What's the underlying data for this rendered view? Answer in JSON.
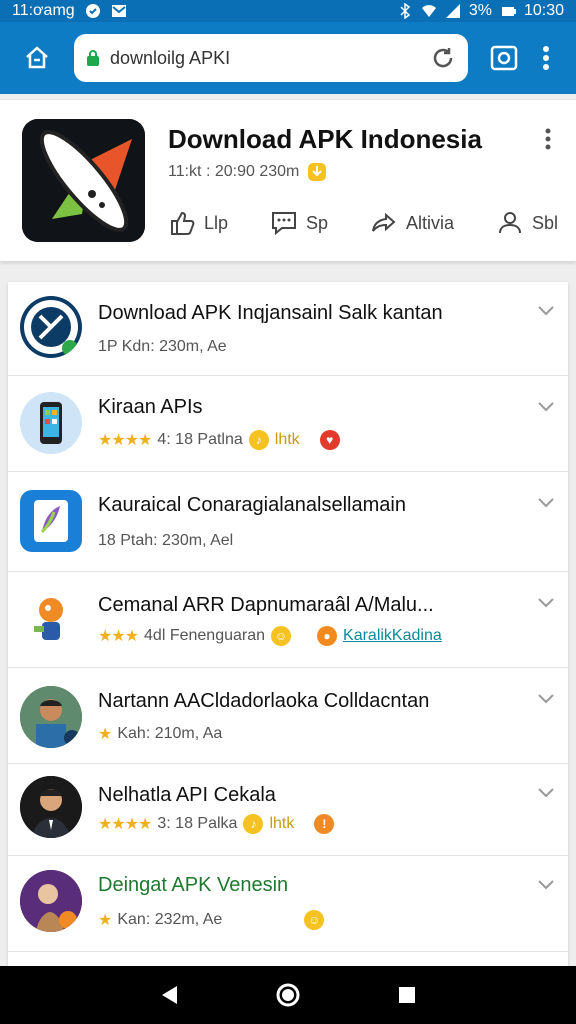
{
  "status_bar": {
    "time_left": "11:ơamg",
    "battery": "3%",
    "time_right": "10:30"
  },
  "browser": {
    "url": "downloilg APKI"
  },
  "app": {
    "title": "Download APK Indonesia",
    "meta": "11:kt : 20:90 230m",
    "actions": [
      {
        "label": "Llp",
        "icon": "thumbs-up-icon"
      },
      {
        "label": "Sp",
        "icon": "comment-icon"
      },
      {
        "label": "Altivia",
        "icon": "share-icon"
      },
      {
        "label": "Sbl",
        "icon": "save-icon"
      }
    ]
  },
  "list": [
    {
      "title": "Download APK Inqjansainl Salk kantan",
      "sub": "1P Kdn: 230m, Ae"
    },
    {
      "title": "Kiraan APIs",
      "stars": "★★★★",
      "sub": "4: 18 Patlna",
      "extra": "lhtk"
    },
    {
      "title": "Kauraical Conaragialanalsellamain",
      "sub": "18 Ptah: 230m, Ael"
    },
    {
      "title": "Cemanal ARR Dapnumaraâl A/Malu...",
      "stars": "★★★",
      "sub": "4dl Fenenguaran",
      "link": "KaralikKadina"
    },
    {
      "title": "Nartann AACldadorlaoka Colldacntan",
      "stars": "★",
      "sub": "Kah: 210m, Aa"
    },
    {
      "title": "Nelhatla API Cekala",
      "stars": "★★★★",
      "sub": "3: 18 Palka",
      "extra": "lhtk"
    },
    {
      "title": "Deingat APK Venesin",
      "stars": "★",
      "sub": "Kan: 232m, Ae"
    }
  ],
  "colors": {
    "toolbar": "#0e7cc4",
    "status": "#0a6fb5",
    "star": "#f2b01e",
    "link": "#0a8a9a"
  }
}
